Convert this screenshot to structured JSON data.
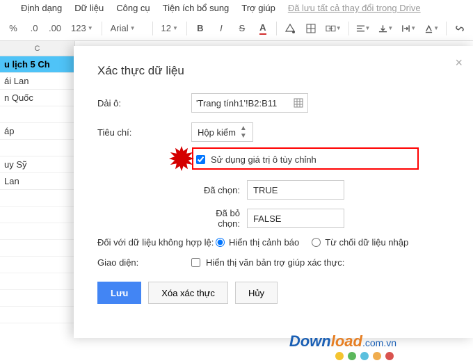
{
  "menu": {
    "format": "Định dạng",
    "data": "Dữ liệu",
    "tools": "Công cụ",
    "addons": "Tiện ích bổ sung",
    "help": "Trợ giúp",
    "saved": "Đã lưu tất cả thay đổi trong Drive"
  },
  "toolbar": {
    "pct": "%",
    "dec_dec": ".0",
    "dec_inc": ".00",
    "format_select": "123",
    "font": "Arial",
    "size": "12",
    "bold": "B",
    "italic": "I",
    "strike": "S",
    "text_color": "A"
  },
  "sheet": {
    "col_label": "C",
    "rows": [
      "u lịch 5 Ch",
      "ái Lan",
      "n Quốc",
      "",
      "áp",
      "",
      "uy Sỹ",
      "Lan"
    ]
  },
  "dialog": {
    "title": "Xác thực dữ liệu",
    "range_label": "Dải ô:",
    "range_value": "'Trang tính1'!B2:B11",
    "criteria_label": "Tiêu chí:",
    "criteria_value": "Hộp kiểm",
    "use_custom": "Sử dụng giá trị ô tùy chỉnh",
    "checked_label": "Đã chọn:",
    "checked_value": "TRUE",
    "unchecked_label": "Đã bỏ chọn:",
    "unchecked_value": "FALSE",
    "invalid_label": "Đối với dữ liệu không hợp lệ:",
    "show_warning": "Hiển thị cảnh báo",
    "reject_input": "Từ chối dữ liệu nhập",
    "appearance_label": "Giao diện:",
    "show_help": "Hiển thị văn bản trợ giúp xác thực:",
    "save": "Lưu",
    "remove": "Xóa xác thực",
    "cancel": "Hủy"
  },
  "watermark": {
    "down": "Down",
    "load": "load",
    "com": ".com.vn"
  },
  "dot_colors": [
    "#f4c430",
    "#5cb85c",
    "#5bc0de",
    "#f0ad4e",
    "#d9534f"
  ]
}
